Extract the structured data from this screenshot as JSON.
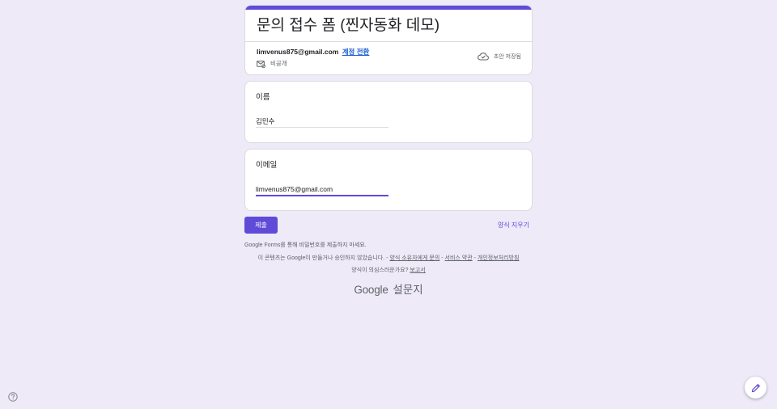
{
  "form": {
    "title": "문의 접수 폼 (찐자동화 데모)",
    "accent_color": "#5f4bd8"
  },
  "account": {
    "email": "limvenus875@gmail.com",
    "switch_label": "계정 전환",
    "visibility": "비공개",
    "draft_status": "초안 저장됨"
  },
  "questions": [
    {
      "label": "이름",
      "value": "김민수"
    },
    {
      "label": "이메일",
      "value": "limvenus875@gmail.com"
    }
  ],
  "actions": {
    "submit_label": "제출",
    "clear_label": "양식 지우기"
  },
  "notices": {
    "password_warning": "Google Forms를 통해 비밀번호를 제출하지 마세요."
  },
  "footer": {
    "disclaimer": "이 콘텐츠는 Google이 만들거나 승인하지 않았습니다. - ",
    "contact_owner_link": "양식 소유자에게 문의",
    "sep1": " - ",
    "terms_link": "서비스 약관",
    "sep2": " - ",
    "privacy_link": "개인정보처리방침",
    "suspicious_text": "양식이 의심스러운가요? ",
    "report_link": "보고서"
  },
  "brand": {
    "google": "Google",
    "product": "설문지"
  },
  "icons": {
    "cloud": "cloud-done-icon",
    "privacy": "private-mail-icon",
    "help": "help-icon",
    "edit": "pencil-edit-icon"
  }
}
